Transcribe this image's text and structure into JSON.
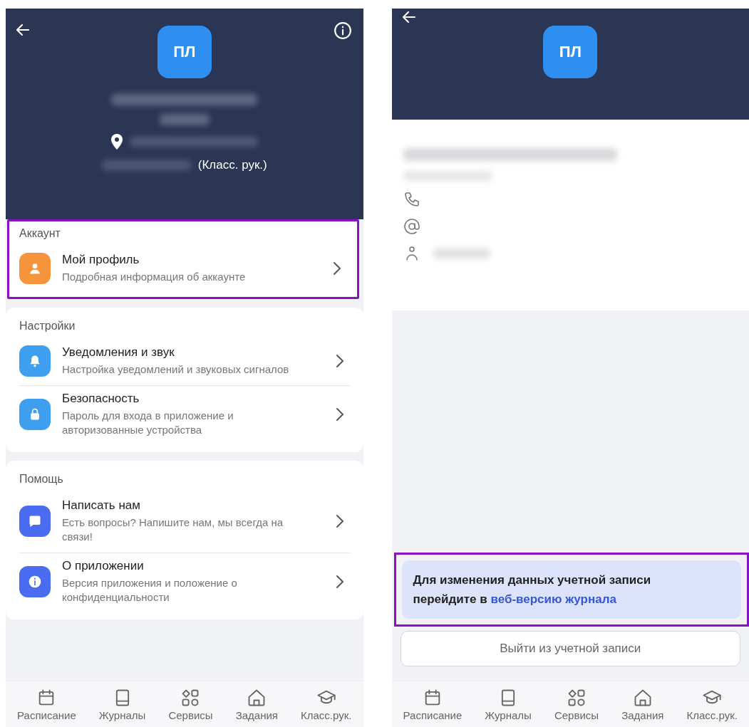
{
  "left_screen": {
    "header": {
      "initials": "ПЛ",
      "role": "(Класс. рук.)"
    },
    "sections": [
      {
        "title": "Аккаунт",
        "highlighted": true,
        "items": [
          {
            "kind": "person",
            "color": "#f5943a",
            "title": "Мой профиль",
            "subtitle": "Подробная информация об аккаунте"
          }
        ]
      },
      {
        "title": "Настройки",
        "highlighted": false,
        "items": [
          {
            "kind": "bell",
            "color": "#3e9ff0",
            "title": "Уведомления и звук",
            "subtitle": "Настройка уведомлений и звуковых сигналов"
          },
          {
            "kind": "lock",
            "color": "#3e9ff0",
            "title": "Безопасность",
            "subtitle": "Пароль для входа в приложение и авторизованные устройства"
          }
        ]
      },
      {
        "title": "Помощь",
        "highlighted": false,
        "items": [
          {
            "kind": "chat",
            "color": "#4a6cf0",
            "title": "Написать нам",
            "subtitle": "Есть вопросы? Напишите нам, мы всегда на связи!"
          },
          {
            "kind": "info",
            "color": "#4a6cf0",
            "title": "О приложении",
            "subtitle": "Версия приложения и положение о конфиденциальности"
          }
        ]
      }
    ],
    "nav": [
      {
        "kind": "calendar",
        "label": "Расписание"
      },
      {
        "kind": "book",
        "label": "Журналы"
      },
      {
        "kind": "grid",
        "label": "Сервисы"
      },
      {
        "kind": "home",
        "label": "Задания"
      },
      {
        "kind": "cap",
        "label": "Класс.рук."
      }
    ]
  },
  "right_screen": {
    "initials": "ПЛ",
    "notice": {
      "text": "Для изменения данных учетной записи перейдите в ",
      "link": "веб-версию журнала",
      "highlighted": true
    },
    "logout_button": "Выйти из учетной записи",
    "nav": [
      {
        "kind": "calendar",
        "label": "Расписание"
      },
      {
        "kind": "book",
        "label": "Журналы"
      },
      {
        "kind": "grid",
        "label": "Сервисы"
      },
      {
        "kind": "home",
        "label": "Задания"
      },
      {
        "kind": "cap",
        "label": "Класс.рук."
      }
    ]
  }
}
